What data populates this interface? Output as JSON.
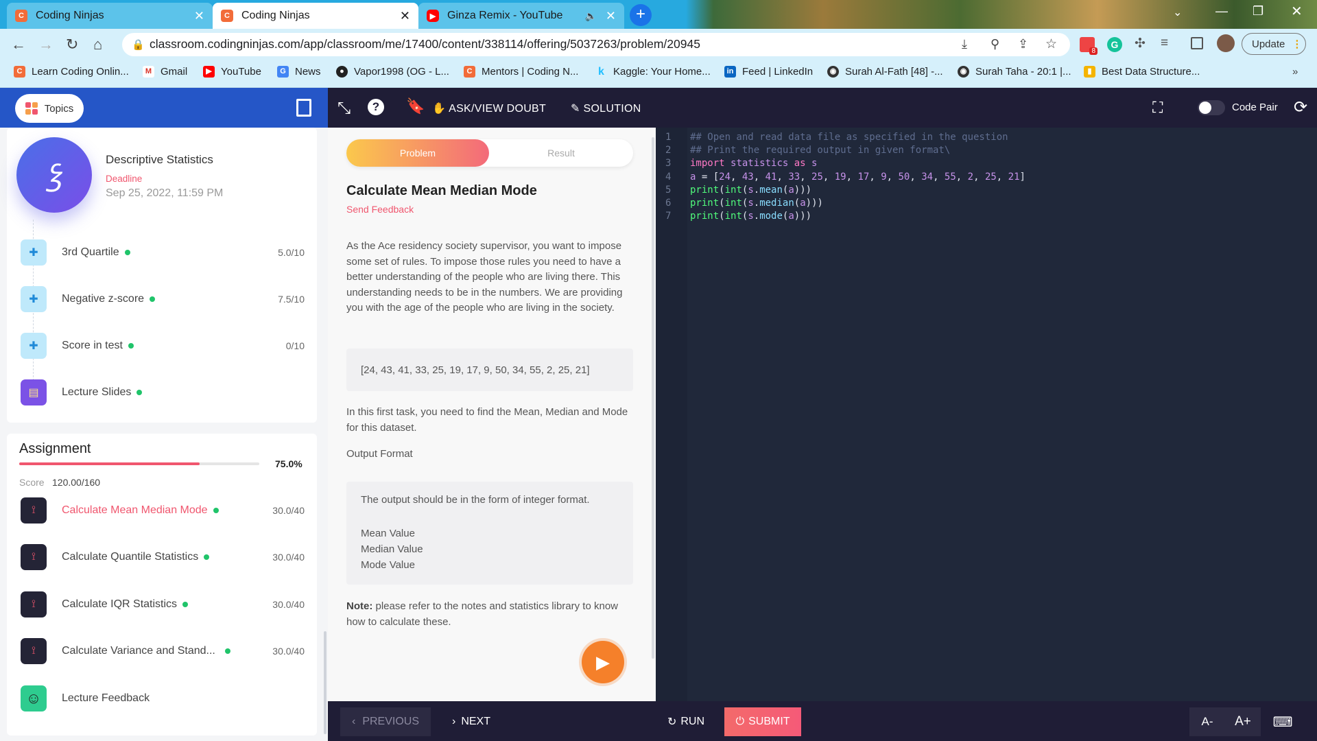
{
  "browser": {
    "tabs": [
      {
        "title": "Coding Ninjas"
      },
      {
        "title": "Coding Ninjas"
      },
      {
        "title": "Ginza Remix - YouTube"
      }
    ],
    "url": "classroom.codingninjas.com/app/classroom/me/17400/content/338114/offering/5037263/problem/20945",
    "update_label": "Update",
    "bookmarks": [
      "Learn Coding Onlin...",
      "Gmail",
      "YouTube",
      "News",
      "Vapor1998 (OG - L...",
      "Mentors | Coding N...",
      "Kaggle: Your Home...",
      "Feed | LinkedIn",
      "Surah Al-Fath [48] -...",
      "Surah Taha - 20:1 |...",
      "Best Data Structure..."
    ],
    "ext_badge": "8"
  },
  "header": {
    "topics_label": "Topics",
    "ask_doubt_label": "ASK/VIEW DOUBT",
    "solution_label": "SOLUTION",
    "code_pair_label": "Code Pair"
  },
  "module": {
    "title": "Descriptive Statistics",
    "deadline_label": "Deadline",
    "deadline": "Sep 25, 2022, 11:59 PM"
  },
  "items": [
    {
      "name": "3rd Quartile",
      "score": "5.0/10"
    },
    {
      "name": "Negative z-score",
      "score": "7.5/10"
    },
    {
      "name": "Score in test",
      "score": "0/10"
    },
    {
      "name": "Lecture Slides",
      "score": ""
    }
  ],
  "assignment": {
    "title": "Assignment",
    "percent": "75.0%",
    "progress": 0.75,
    "score_label": "Score",
    "score": "120.00/160",
    "items": [
      {
        "name": "Calculate Mean Median Mode",
        "score": "30.0/40"
      },
      {
        "name": "Calculate Quantile Statistics",
        "score": "30.0/40"
      },
      {
        "name": "Calculate IQR Statistics",
        "score": "30.0/40"
      },
      {
        "name": "Calculate Variance and Stand...",
        "score": "30.0/40"
      }
    ],
    "feedback_label": "Lecture Feedback"
  },
  "problem": {
    "tab_problem": "Problem",
    "tab_result": "Result",
    "title": "Calculate Mean Median Mode",
    "send_feedback": "Send Feedback",
    "description": "As the Ace residency society supervisor, you want to impose some set of rules. To impose those rules you need to have a better understanding of the people who are living there. This understanding needs to be in the numbers. We are providing you with the age of the people who are living in the society.",
    "dataset": "[24, 43, 41, 33, 25, 19, 17, 9, 50, 34, 55, 2, 25, 21]",
    "task": "In this first task, you need to find the Mean, Median and Mode for this dataset.",
    "output_heading": "Output Format",
    "output_desc": "The output should be in the form of integer format.",
    "output_lines": [
      "Mean Value",
      "Median Value",
      "Mode Value"
    ],
    "note_label": "Note:",
    "note": " please refer to the notes and statistics library to know how to calculate these."
  },
  "editor": {
    "line_numbers": [
      "1",
      "2",
      "3",
      "4",
      "5",
      "6",
      "7"
    ]
  },
  "footer": {
    "previous_label": "PREVIOUS",
    "next_label": "NEXT",
    "run_label": "RUN",
    "submit_label": "SUBMIT",
    "font_down_label": "A-",
    "font_up_label": "A+"
  },
  "colors": {
    "accent_red": "#f0566e",
    "green_dot": "#20c46a",
    "header_dark": "#1f1d36",
    "header_blue": "#2556c7"
  }
}
